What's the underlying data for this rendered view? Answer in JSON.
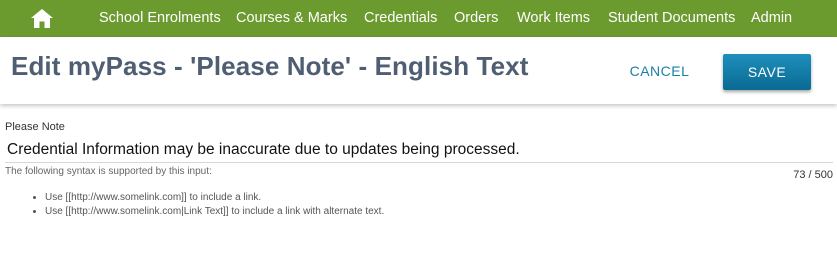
{
  "nav": {
    "home_icon": "home-icon",
    "items": [
      "School Enrolments",
      "Courses & Marks",
      "Credentials",
      "Orders",
      "Work Items",
      "Student Documents",
      "Admin"
    ]
  },
  "header": {
    "title": "Edit myPass - 'Please Note' - English Text",
    "cancel_label": "CANCEL",
    "save_label": "SAVE"
  },
  "form": {
    "field_label": "Please Note",
    "field_value": "Credential Information may be inaccurate due to updates being processed.",
    "counter": "73 / 500",
    "syntax_note": "The following syntax is supported by this input:",
    "syntax_items": [
      "Use [[http://www.somelink.com]] to include a link.",
      "Use [[http://www.somelink.com|Link Text]] to include a link with alternate text."
    ]
  },
  "colors": {
    "nav_background": "#6b9a2f",
    "title_text": "#4f5e72",
    "accent": "#1a7fa8",
    "save_background": "#0a6a93"
  }
}
